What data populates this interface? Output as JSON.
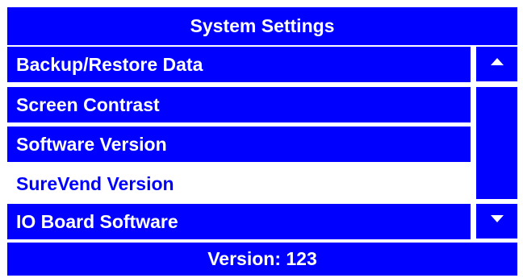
{
  "header": {
    "title": "System Settings"
  },
  "menu": {
    "items": [
      {
        "label": "Backup/Restore Data"
      },
      {
        "label": "Screen Contrast"
      },
      {
        "label": "Software Version"
      },
      {
        "label": "SureVend Version",
        "selected": true
      },
      {
        "label": "IO Board Software"
      }
    ]
  },
  "scrollbar": {
    "up_icon": "triangle-up-icon",
    "down_icon": "triangle-down-icon"
  },
  "footer": {
    "status": "Version: 123"
  },
  "colors": {
    "accent": "#0000ff",
    "text_on_accent": "#ffffff",
    "selected_bg": "#ffffff"
  }
}
